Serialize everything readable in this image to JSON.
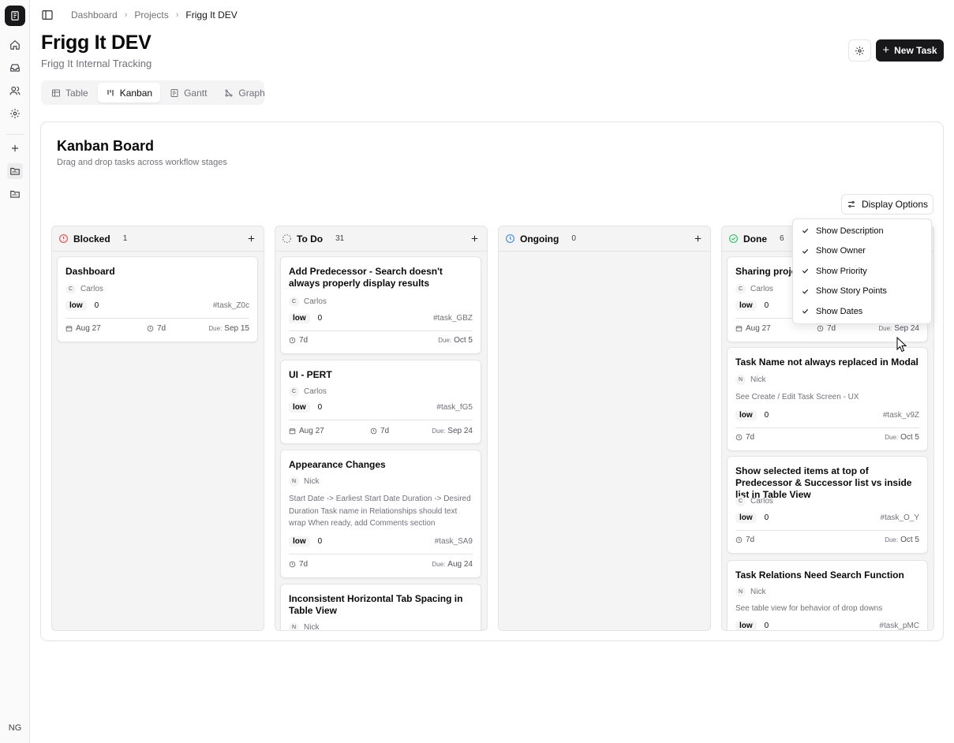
{
  "sidebar": {
    "user_initials": "NG"
  },
  "breadcrumb": [
    "Dashboard",
    "Projects",
    "Frigg It DEV"
  ],
  "header": {
    "title": "Frigg It DEV",
    "subtitle": "Frigg It Internal Tracking",
    "new_task_label": "New Task"
  },
  "views": [
    {
      "label": "Table",
      "icon": "table-icon"
    },
    {
      "label": "Kanban",
      "icon": "kanban-icon",
      "active": true
    },
    {
      "label": "Gantt",
      "icon": "gantt-icon"
    },
    {
      "label": "Graph",
      "icon": "graph-icon"
    }
  ],
  "board": {
    "title": "Kanban Board",
    "subtitle": "Drag and drop tasks across workflow stages",
    "display_options_label": "Display Options"
  },
  "columns": [
    {
      "name": "Blocked",
      "count": "1",
      "status_color": "#ef4444",
      "cards": [
        {
          "title": "Dashboard",
          "owner": "Carlos",
          "initial": "C",
          "priority": "low",
          "points": "0",
          "id": "#task_Z0c",
          "start": "Aug 27",
          "duration": "7d",
          "due": "Sep 15"
        }
      ]
    },
    {
      "name": "To Do",
      "count": "31",
      "status_color": "#71717a",
      "cards": [
        {
          "title": "Add Predecessor - Search doesn't always properly display results",
          "owner": "Carlos",
          "initial": "C",
          "priority": "low",
          "points": "0",
          "id": "#task_GBZ",
          "duration": "7d",
          "due": "Oct 5"
        },
        {
          "title": "UI - PERT",
          "owner": "Carlos",
          "initial": "C",
          "priority": "low",
          "points": "0",
          "id": "#task_fG5",
          "start": "Aug 27",
          "duration": "7d",
          "due": "Sep 24"
        },
        {
          "title": "Appearance Changes",
          "owner": "Nick",
          "initial": "N",
          "description": "Start Date -> Earliest Start Date Duration -> Desired Duration Task name in Relationships should text wrap When ready, add Comments section",
          "priority": "low",
          "points": "0",
          "id": "#task_SA9",
          "duration": "7d",
          "due": "Aug 24"
        },
        {
          "title": "Inconsistent Horizontal Tab Spacing in Table View",
          "owner": "Nick",
          "initial": "N"
        }
      ]
    },
    {
      "name": "Ongoing",
      "count": "0",
      "status_color": "#3b82f6",
      "cards": []
    },
    {
      "name": "Done",
      "count": "6",
      "status_color": "#22c55e",
      "cards": [
        {
          "title": "Sharing projec",
          "owner": "Carlos",
          "initial": "C",
          "priority": "low",
          "points": "0",
          "start": "Aug 27",
          "duration": "7d",
          "due": "Sep 24"
        },
        {
          "title": "Task Name not always replaced in Modal",
          "owner": "Nick",
          "initial": "N",
          "description": "See Create / Edit Task Screen - UX",
          "priority": "low",
          "points": "0",
          "id": "#task_v9Z",
          "duration": "7d",
          "due": "Oct 5"
        },
        {
          "title": "Show selected items at top of Predecessor & Successor list vs inside list in Table View",
          "owner": "Carlos",
          "initial": "C",
          "priority": "low",
          "points": "0",
          "id": "#task_O_Y",
          "duration": "7d",
          "due": "Oct 5"
        },
        {
          "title": "Task Relations Need Search Function",
          "owner": "Nick",
          "initial": "N",
          "description": "See table view for behavior of drop downs",
          "priority": "low",
          "points": "0",
          "id": "#task_pMC"
        }
      ]
    }
  ],
  "due_label": "Due:",
  "display_menu": [
    "Show Description",
    "Show Owner",
    "Show Priority",
    "Show Story Points",
    "Show Dates"
  ]
}
